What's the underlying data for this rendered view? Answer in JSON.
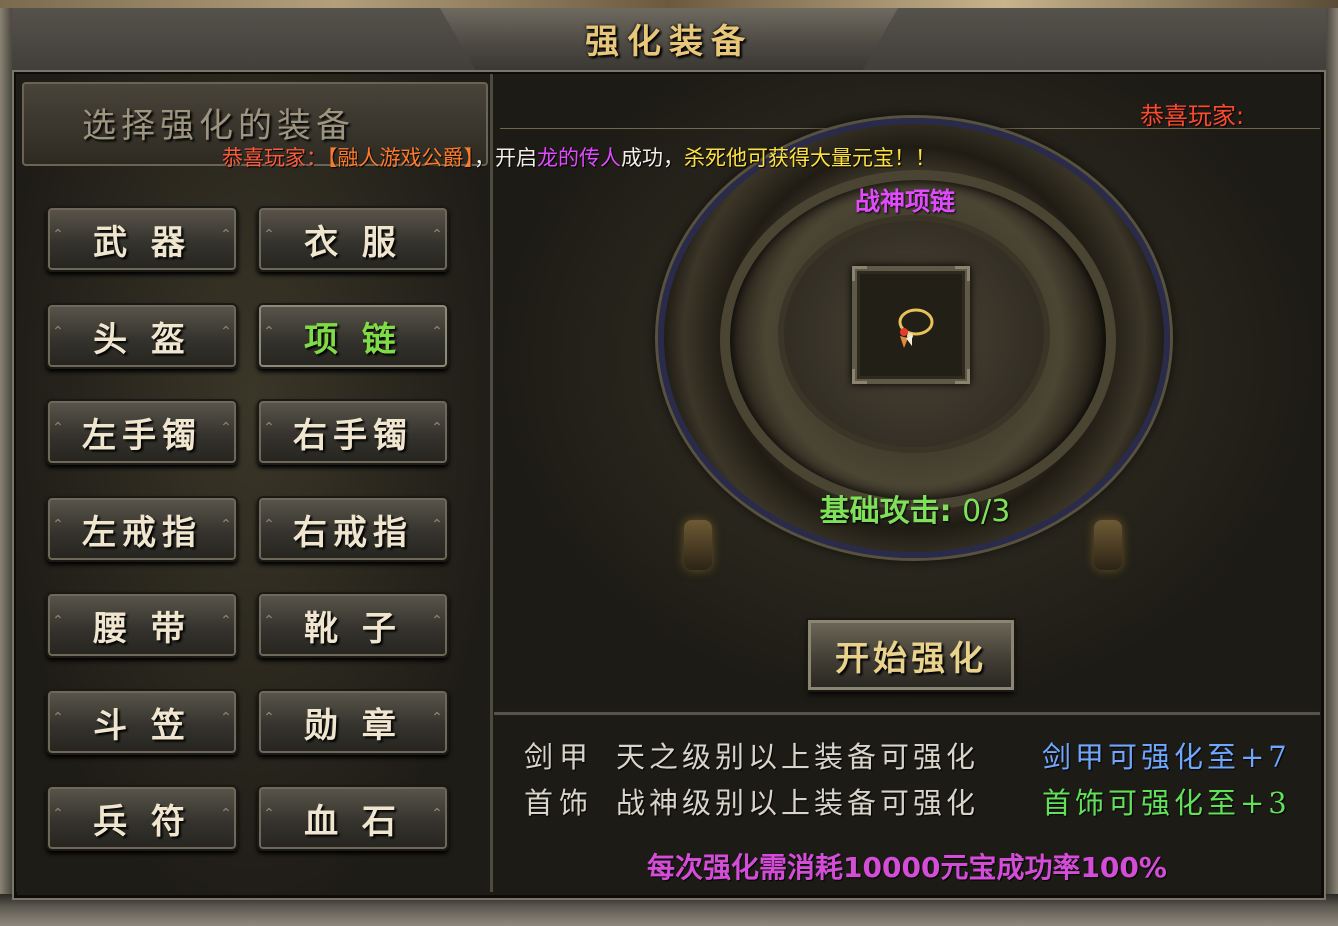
{
  "window": {
    "title": "强化装备"
  },
  "left_panel": {
    "title": "选择强化的装备",
    "equipment_slots": [
      {
        "label": "武 器",
        "selected": false
      },
      {
        "label": "衣 服",
        "selected": false
      },
      {
        "label": "头 盔",
        "selected": false
      },
      {
        "label": "项 链",
        "selected": true
      },
      {
        "label": "左手镯",
        "selected": false
      },
      {
        "label": "右手镯",
        "selected": false
      },
      {
        "label": "左戒指",
        "selected": false
      },
      {
        "label": "右戒指",
        "selected": false
      },
      {
        "label": "腰 带",
        "selected": false
      },
      {
        "label": "靴 子",
        "selected": false
      },
      {
        "label": "斗 笠",
        "selected": false
      },
      {
        "label": "勋 章",
        "selected": false
      },
      {
        "label": "兵 符",
        "selected": false
      },
      {
        "label": "血 石",
        "selected": false
      }
    ]
  },
  "broadcast": {
    "prefix": "恭喜玩家：",
    "player": "【融人游戏公爵】",
    "middle": "，开启",
    "target": "龙的传人",
    "suffix1": "成功，",
    "suffix2": "杀死他可获得大量元宝！！"
  },
  "right_panel": {
    "congrats_label": "恭喜玩家:",
    "item_name": "战神项链",
    "item_icon": "necklace-icon",
    "base_attack_label": "基础攻击:",
    "base_attack_value": "0/3",
    "start_button_label": "开始强化"
  },
  "info_panel": {
    "rows": [
      {
        "category": "剑甲",
        "requirement": "天之级别以上装备可强化",
        "limit": "剑甲可强化至+7",
        "limit_color": "#6fa6ff"
      },
      {
        "category": "首饰",
        "requirement": "战神级别以上装备可强化",
        "limit": "首饰可强化至+3",
        "limit_color": "#63e05a"
      }
    ],
    "cost_text": "每次强化需消耗10000元宝成功率100%"
  },
  "colors": {
    "title_gold": "#e8c77a",
    "selected_green": "#7fdc46",
    "highlight_purple": "#e04bff",
    "announcement_red": "#ff4a2e"
  }
}
